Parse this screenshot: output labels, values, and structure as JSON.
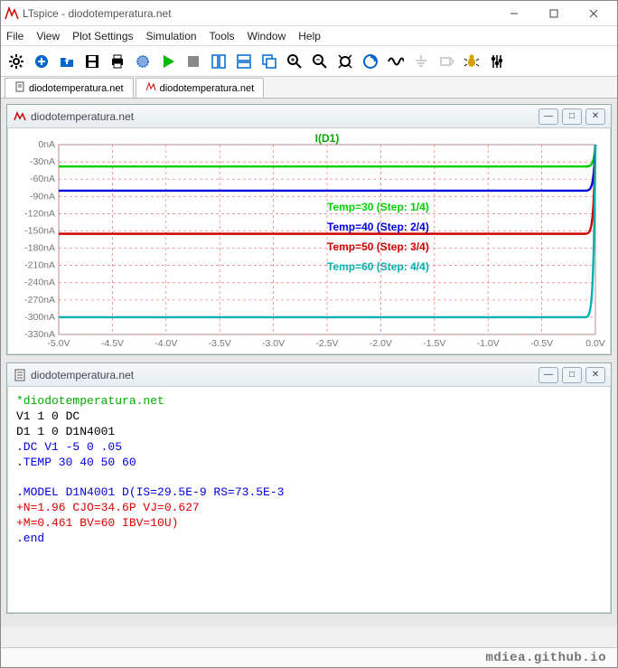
{
  "window": {
    "title": "LTspice - diodotemperatura.net"
  },
  "menu": [
    "File",
    "View",
    "Plot Settings",
    "Simulation",
    "Tools",
    "Window",
    "Help"
  ],
  "tabs": [
    {
      "label": "diodotemperatura.net",
      "icon": "netlist"
    },
    {
      "label": "diodotemperatura.net",
      "icon": "wave"
    }
  ],
  "plot_window": {
    "title": "diodotemperatura.net",
    "trace_title": "I(D1)"
  },
  "netlist_window": {
    "title": "diodotemperatura.net",
    "lines": [
      {
        "text": "*diodotemperatura.net",
        "cls": "nl-comment"
      },
      {
        "text": "V1 1 0 DC",
        "cls": ""
      },
      {
        "text": "D1 1 0 D1N4001",
        "cls": ""
      },
      {
        "text": ".DC V1 -5 0 .05",
        "cls": "nl-dot"
      },
      {
        "text": ".TEMP 30 40 50 60",
        "cls": "nl-dot"
      },
      {
        "text": "",
        "cls": ""
      },
      {
        "text": ".MODEL D1N4001 D(IS=29.5E-9 RS=73.5E-3",
        "cls": "nl-dot"
      },
      {
        "text": "+N=1.96 CJO=34.6P VJ=0.627",
        "cls": "nl-cont"
      },
      {
        "text": "+M=0.461 BV=60 IBV=10U)",
        "cls": "nl-cont"
      },
      {
        "text": ".end",
        "cls": "nl-dot"
      }
    ]
  },
  "credit_text": "mdiea.github.io",
  "chart_data": {
    "type": "line",
    "title": "I(D1)",
    "xlabel": "V",
    "ylabel": "I",
    "xlim": [
      -5.0,
      0.0
    ],
    "ylim": [
      -330,
      0
    ],
    "x_ticks": [
      "-5.0V",
      "-4.5V",
      "-4.0V",
      "-3.5V",
      "-3.0V",
      "-2.5V",
      "-2.0V",
      "-1.5V",
      "-1.0V",
      "-0.5V",
      "0.0V"
    ],
    "y_ticks": [
      "0nA",
      "-30nA",
      "-60nA",
      "-90nA",
      "-120nA",
      "-150nA",
      "-180nA",
      "-210nA",
      "-240nA",
      "-270nA",
      "-300nA",
      "-330nA"
    ],
    "series": [
      {
        "name": "Temp=30",
        "step": "(Step: 1/4)",
        "plateau_nA": -38,
        "color": "#00d000"
      },
      {
        "name": "Temp=40",
        "step": "(Step: 2/4)",
        "plateau_nA": -80,
        "color": "#0000e0"
      },
      {
        "name": "Temp=50",
        "step": "(Step: 3/4)",
        "plateau_nA": -155,
        "color": "#d00000"
      },
      {
        "name": "Temp=60",
        "step": "(Step: 4/4)",
        "plateau_nA": -300,
        "color": "#00b0b0"
      }
    ],
    "annotations": [
      {
        "text": "Temp=30  (Step: 1/4)",
        "color": "#00d000"
      },
      {
        "text": "Temp=40  (Step: 2/4)",
        "color": "#0000e0"
      },
      {
        "text": "Temp=50  (Step: 3/4)",
        "color": "#d00000"
      },
      {
        "text": "Temp=60  (Step: 4/4)",
        "color": "#00b0b0"
      }
    ]
  }
}
